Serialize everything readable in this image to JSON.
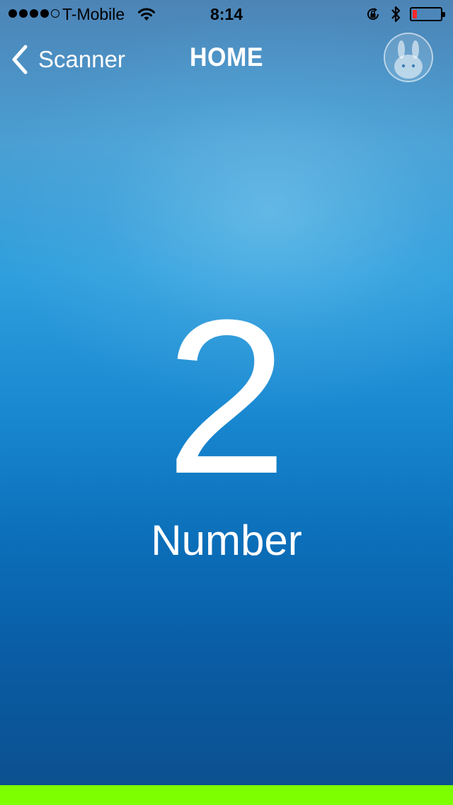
{
  "status_bar": {
    "carrier": "T-Mobile",
    "time": "8:14",
    "signal_bars_filled": 4,
    "signal_bars_total": 5,
    "battery_level": 0.15,
    "battery_color": "#ff2a2a",
    "icons": [
      "wifi-icon",
      "rotation-lock-icon",
      "bluetooth-icon",
      "battery-icon"
    ]
  },
  "nav": {
    "back_label": "Scanner",
    "title": "HOME",
    "avatar_icon": "bunny-avatar-icon"
  },
  "main": {
    "count": "2",
    "count_label": "Number"
  },
  "colors": {
    "bottom_bar": "#7dff00",
    "background_top": "#4d84b6",
    "background_bottom": "#0c4f8c"
  }
}
